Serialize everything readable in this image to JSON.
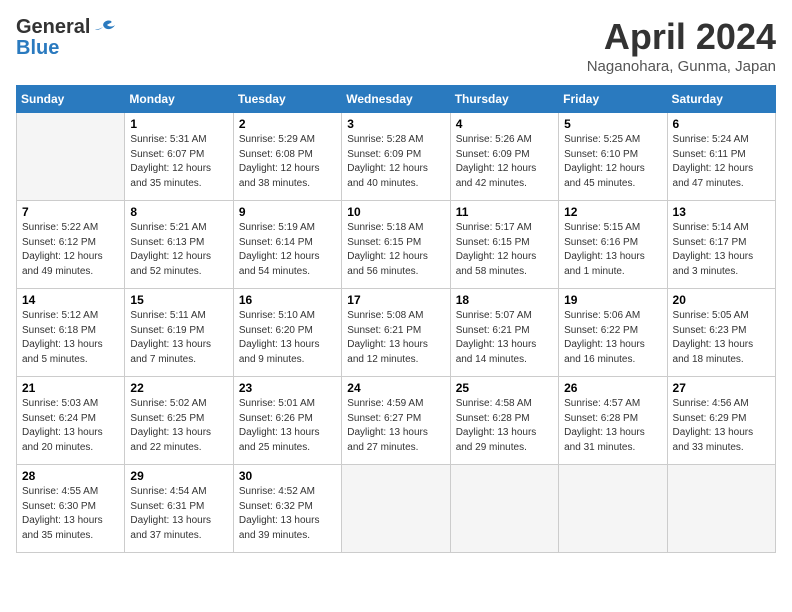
{
  "header": {
    "logo_general": "General",
    "logo_blue": "Blue",
    "month": "April 2024",
    "location": "Naganohara, Gunma, Japan"
  },
  "days_of_week": [
    "Sunday",
    "Monday",
    "Tuesday",
    "Wednesday",
    "Thursday",
    "Friday",
    "Saturday"
  ],
  "weeks": [
    [
      {
        "day": "",
        "info": ""
      },
      {
        "day": "1",
        "info": "Sunrise: 5:31 AM\nSunset: 6:07 PM\nDaylight: 12 hours\nand 35 minutes."
      },
      {
        "day": "2",
        "info": "Sunrise: 5:29 AM\nSunset: 6:08 PM\nDaylight: 12 hours\nand 38 minutes."
      },
      {
        "day": "3",
        "info": "Sunrise: 5:28 AM\nSunset: 6:09 PM\nDaylight: 12 hours\nand 40 minutes."
      },
      {
        "day": "4",
        "info": "Sunrise: 5:26 AM\nSunset: 6:09 PM\nDaylight: 12 hours\nand 42 minutes."
      },
      {
        "day": "5",
        "info": "Sunrise: 5:25 AM\nSunset: 6:10 PM\nDaylight: 12 hours\nand 45 minutes."
      },
      {
        "day": "6",
        "info": "Sunrise: 5:24 AM\nSunset: 6:11 PM\nDaylight: 12 hours\nand 47 minutes."
      }
    ],
    [
      {
        "day": "7",
        "info": "Sunrise: 5:22 AM\nSunset: 6:12 PM\nDaylight: 12 hours\nand 49 minutes."
      },
      {
        "day": "8",
        "info": "Sunrise: 5:21 AM\nSunset: 6:13 PM\nDaylight: 12 hours\nand 52 minutes."
      },
      {
        "day": "9",
        "info": "Sunrise: 5:19 AM\nSunset: 6:14 PM\nDaylight: 12 hours\nand 54 minutes."
      },
      {
        "day": "10",
        "info": "Sunrise: 5:18 AM\nSunset: 6:15 PM\nDaylight: 12 hours\nand 56 minutes."
      },
      {
        "day": "11",
        "info": "Sunrise: 5:17 AM\nSunset: 6:15 PM\nDaylight: 12 hours\nand 58 minutes."
      },
      {
        "day": "12",
        "info": "Sunrise: 5:15 AM\nSunset: 6:16 PM\nDaylight: 13 hours\nand 1 minute."
      },
      {
        "day": "13",
        "info": "Sunrise: 5:14 AM\nSunset: 6:17 PM\nDaylight: 13 hours\nand 3 minutes."
      }
    ],
    [
      {
        "day": "14",
        "info": "Sunrise: 5:12 AM\nSunset: 6:18 PM\nDaylight: 13 hours\nand 5 minutes."
      },
      {
        "day": "15",
        "info": "Sunrise: 5:11 AM\nSunset: 6:19 PM\nDaylight: 13 hours\nand 7 minutes."
      },
      {
        "day": "16",
        "info": "Sunrise: 5:10 AM\nSunset: 6:20 PM\nDaylight: 13 hours\nand 9 minutes."
      },
      {
        "day": "17",
        "info": "Sunrise: 5:08 AM\nSunset: 6:21 PM\nDaylight: 13 hours\nand 12 minutes."
      },
      {
        "day": "18",
        "info": "Sunrise: 5:07 AM\nSunset: 6:21 PM\nDaylight: 13 hours\nand 14 minutes."
      },
      {
        "day": "19",
        "info": "Sunrise: 5:06 AM\nSunset: 6:22 PM\nDaylight: 13 hours\nand 16 minutes."
      },
      {
        "day": "20",
        "info": "Sunrise: 5:05 AM\nSunset: 6:23 PM\nDaylight: 13 hours\nand 18 minutes."
      }
    ],
    [
      {
        "day": "21",
        "info": "Sunrise: 5:03 AM\nSunset: 6:24 PM\nDaylight: 13 hours\nand 20 minutes."
      },
      {
        "day": "22",
        "info": "Sunrise: 5:02 AM\nSunset: 6:25 PM\nDaylight: 13 hours\nand 22 minutes."
      },
      {
        "day": "23",
        "info": "Sunrise: 5:01 AM\nSunset: 6:26 PM\nDaylight: 13 hours\nand 25 minutes."
      },
      {
        "day": "24",
        "info": "Sunrise: 4:59 AM\nSunset: 6:27 PM\nDaylight: 13 hours\nand 27 minutes."
      },
      {
        "day": "25",
        "info": "Sunrise: 4:58 AM\nSunset: 6:28 PM\nDaylight: 13 hours\nand 29 minutes."
      },
      {
        "day": "26",
        "info": "Sunrise: 4:57 AM\nSunset: 6:28 PM\nDaylight: 13 hours\nand 31 minutes."
      },
      {
        "day": "27",
        "info": "Sunrise: 4:56 AM\nSunset: 6:29 PM\nDaylight: 13 hours\nand 33 minutes."
      }
    ],
    [
      {
        "day": "28",
        "info": "Sunrise: 4:55 AM\nSunset: 6:30 PM\nDaylight: 13 hours\nand 35 minutes."
      },
      {
        "day": "29",
        "info": "Sunrise: 4:54 AM\nSunset: 6:31 PM\nDaylight: 13 hours\nand 37 minutes."
      },
      {
        "day": "30",
        "info": "Sunrise: 4:52 AM\nSunset: 6:32 PM\nDaylight: 13 hours\nand 39 minutes."
      },
      {
        "day": "",
        "info": ""
      },
      {
        "day": "",
        "info": ""
      },
      {
        "day": "",
        "info": ""
      },
      {
        "day": "",
        "info": ""
      }
    ]
  ]
}
